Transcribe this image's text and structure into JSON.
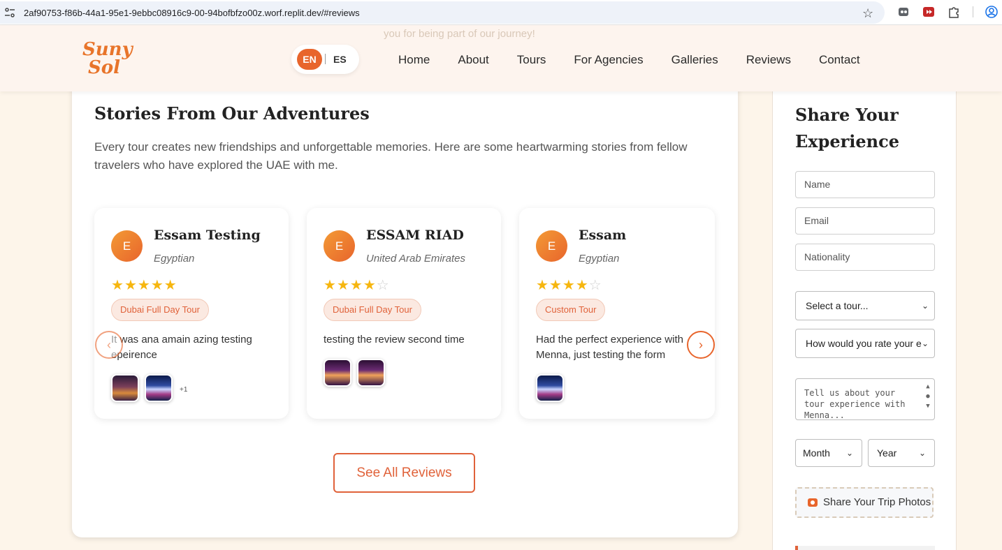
{
  "browser": {
    "url": "2af90753-f86b-44a1-95e1-9ebbc08916c9-00-94bofbfzo00z.worf.replit.dev/#reviews"
  },
  "header": {
    "ghost_text": "you for being part of our journey!",
    "logo_line1": "Suny",
    "logo_line2": "Sol",
    "lang_en": "EN",
    "lang_es": "ES",
    "nav": [
      "Home",
      "About",
      "Tours",
      "For Agencies",
      "Galleries",
      "Reviews",
      "Contact"
    ]
  },
  "reviews_section": {
    "title": "Stories From Our Adventures",
    "description": "Every tour creates new friendships and unforgettable memories. Here are some heartwarming stories from fellow travelers who have explored the UAE with me.",
    "cards": [
      {
        "initial": "E",
        "name": "Essam Testing",
        "nationality": "Egyptian",
        "rating": 5,
        "tour": "Dubai Full Day Tour",
        "text": "It was ana amain azing testing epeirence",
        "more_photos": "+1"
      },
      {
        "initial": "E",
        "name": "ESSAM RIAD",
        "nationality": "United Arab Emirates",
        "rating": 4,
        "tour": "Dubai Full Day Tour",
        "text": "testing the review second time",
        "more_photos": ""
      },
      {
        "initial": "E",
        "name": "Essam",
        "nationality": "Egyptian",
        "rating": 4,
        "tour": "Custom Tour",
        "text": "Had the perfect experience with Menna, just testing the form",
        "more_photos": ""
      }
    ],
    "see_all_label": "See All Reviews"
  },
  "form": {
    "title": "Share Your Experience",
    "name_placeholder": "Name",
    "email_placeholder": "Email",
    "nationality_placeholder": "Nationality",
    "tour_select": "Select a tour...",
    "rating_select": "How would you rate your e",
    "message_placeholder": "Tell us about your tour experience with Menna...",
    "month_select": "Month",
    "year_select": "Year",
    "photos_button": "Share Your Trip Photos"
  },
  "colors": {
    "accent": "#e8652c",
    "page_bg": "#fdf5ea",
    "star": "#f6b60f"
  }
}
